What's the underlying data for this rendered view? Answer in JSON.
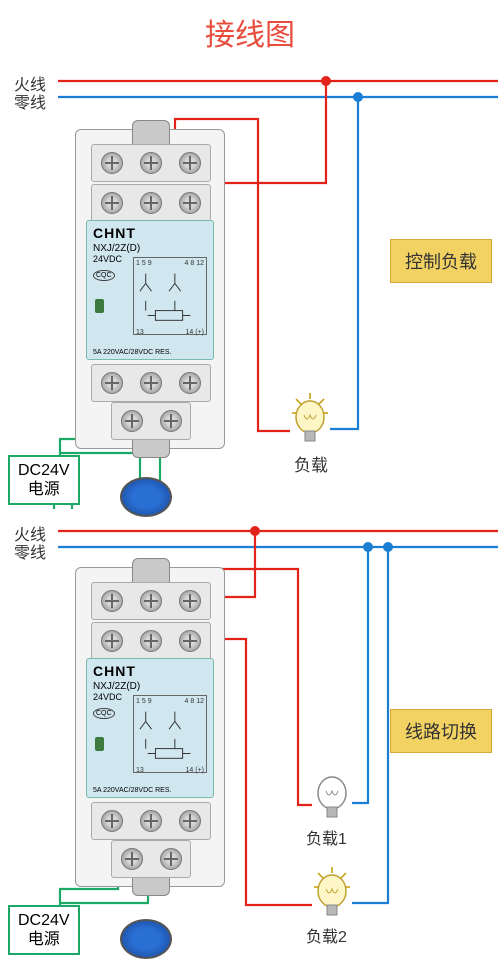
{
  "title": "接线图",
  "common": {
    "live_label": "火线",
    "neutral_label": "零线",
    "brand": "CHNT",
    "model": "NXJ/2Z(D)",
    "voltage": "24VDC",
    "cert": "CQC",
    "rating": "5A 220VAC/28VDC RES.",
    "power_label": "DC24V\n电源",
    "schematic_pins": {
      "tl1": "1",
      "tl2": "5",
      "tl3": "9",
      "tr1": "4",
      "tr2": "8",
      "tr3": "12",
      "bl": "13",
      "br": "14 (+)"
    }
  },
  "section1": {
    "callout": "控制负载",
    "load_label": "负载"
  },
  "section2": {
    "callout": "线路切换",
    "load1_label": "负载1",
    "load2_label": "负载2"
  }
}
